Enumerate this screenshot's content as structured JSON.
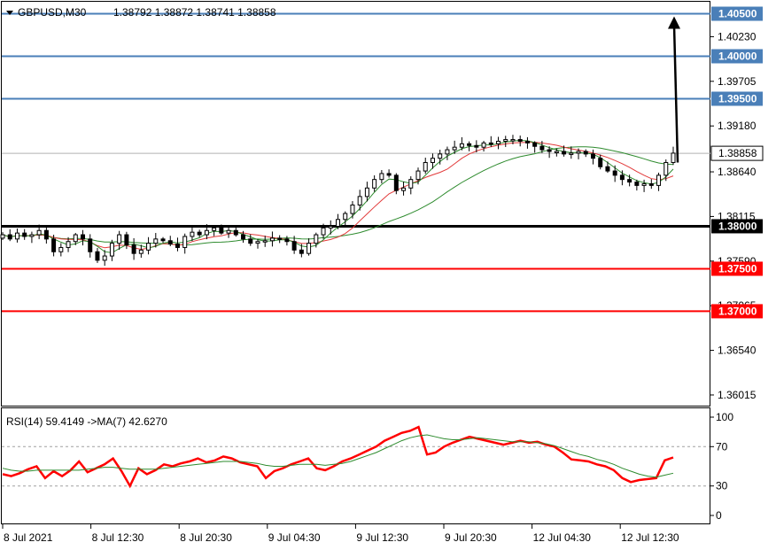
{
  "header": {
    "symbol_label": "GBPUSD,M30",
    "ohlc": "1.38792 1.38872 1.38741 1.38858"
  },
  "indicator": {
    "label": "RSI(14) 59.4149 ->MA(7) 42.6270",
    "levels": [
      "100",
      "70",
      "30",
      "0"
    ]
  },
  "colors": {
    "candle": "#000000",
    "ma_fast": "#2e8b2e",
    "ma_mid": "#e23a3a",
    "ma_slow": "#2e8b2e",
    "resistance": "#4a7fb8",
    "support_red": "#ff0000",
    "pivot": "#000000",
    "rsi": "#ff0000",
    "rsi_ma": "#2e8b2e"
  },
  "chart_data": [
    {
      "type": "candlestick",
      "symbol": "GBPUSD",
      "timeframe": "M30",
      "price_axis_labels": [
        "1.40230",
        "1.39705",
        "1.39180",
        "1.38640",
        "1.38115",
        "1.37590",
        "1.37065",
        "1.36540",
        "1.36015"
      ],
      "current_price_label": "1.38858",
      "ylim": [
        1.359,
        1.4062
      ],
      "time_axis_labels": [
        "8 Jul 2021",
        "8 Jul 12:30",
        "8 Jul 20:30",
        "9 Jul 04:30",
        "9 Jul 12:30",
        "9 Jul 20:30",
        "12 Jul 04:30",
        "12 Jul 12:30"
      ],
      "horizontal_levels": [
        {
          "price": 1.405,
          "label": "1.40500",
          "kind": "resistance"
        },
        {
          "price": 1.4,
          "label": "1.40000",
          "kind": "resistance"
        },
        {
          "price": 1.395,
          "label": "1.39500",
          "kind": "resistance"
        },
        {
          "price": 1.38,
          "label": "1.38000",
          "kind": "pivot"
        },
        {
          "price": 1.375,
          "label": "1.37500",
          "kind": "support_red"
        },
        {
          "price": 1.37,
          "label": "1.37000",
          "kind": "support_red"
        }
      ],
      "close_path": [
        1.379,
        1.3785,
        1.3792,
        1.3788,
        1.379,
        1.3795,
        1.3785,
        1.377,
        1.3775,
        1.3782,
        1.379,
        1.3785,
        1.377,
        1.376,
        1.3765,
        1.378,
        1.379,
        1.3778,
        1.3768,
        1.3772,
        1.378,
        1.3785,
        1.3783,
        1.3779,
        1.3775,
        1.3788,
        1.3793,
        1.379,
        1.3795,
        1.3798,
        1.3792,
        1.3795,
        1.379,
        1.3785,
        1.378,
        1.3782,
        1.3783,
        1.3786,
        1.3785,
        1.3782,
        1.3772,
        1.3768,
        1.378,
        1.379,
        1.3798,
        1.38,
        1.3808,
        1.3815,
        1.3825,
        1.3835,
        1.3845,
        1.3855,
        1.3862,
        1.386,
        1.3842,
        1.3845,
        1.3855,
        1.3865,
        1.3875,
        1.388,
        1.3885,
        1.389,
        1.3893,
        1.3897,
        1.3895,
        1.3893,
        1.3898,
        1.3897,
        1.39,
        1.3902,
        1.3902,
        1.39,
        1.3898,
        1.3894,
        1.389,
        1.3888,
        1.3888,
        1.3885,
        1.3886,
        1.3888,
        1.3885,
        1.388,
        1.387,
        1.3865,
        1.386,
        1.3855,
        1.3852,
        1.3848,
        1.385,
        1.3848,
        1.386,
        1.3875,
        1.3886
      ],
      "projection_arrow": {
        "from_price": 1.3875,
        "to_price": 1.405
      }
    },
    {
      "type": "line",
      "name": "RSI(14)",
      "ylim": [
        0,
        100
      ],
      "levels": [
        70,
        30
      ],
      "series": [
        {
          "name": "RSI(14)",
          "values": [
            42,
            40,
            43,
            47,
            50,
            38,
            45,
            40,
            46,
            55,
            44,
            48,
            52,
            58,
            45,
            30,
            48,
            42,
            46,
            52,
            50,
            53,
            55,
            58,
            54,
            56,
            60,
            58,
            54,
            52,
            50,
            38,
            45,
            48,
            52,
            55,
            58,
            48,
            46,
            50,
            55,
            58,
            62,
            66,
            70,
            76,
            80,
            84,
            86,
            90,
            62,
            64,
            70,
            74,
            77,
            80,
            78,
            76,
            74,
            72,
            74,
            76,
            74,
            75,
            72,
            70,
            64,
            57,
            56,
            55,
            52,
            50,
            46,
            38,
            34,
            36,
            37,
            38,
            56,
            59
          ]
        },
        {
          "name": "MA(7)",
          "values": [
            48,
            46,
            45,
            45,
            46,
            46,
            46,
            46,
            46,
            46,
            47,
            48,
            49,
            49,
            48,
            47,
            47,
            47,
            47,
            48,
            49,
            50,
            51,
            52,
            53,
            54,
            55,
            55,
            55,
            54,
            53,
            51,
            50,
            50,
            51,
            52,
            52,
            52,
            51,
            52,
            53,
            55,
            58,
            61,
            64,
            68,
            72,
            76,
            79,
            81,
            82,
            80,
            78,
            77,
            77,
            78,
            79,
            78,
            77,
            76,
            75,
            75,
            75,
            74,
            73,
            71,
            68,
            65,
            62,
            60,
            57,
            55,
            52,
            48,
            45,
            42,
            40,
            39,
            41,
            43
          ]
        }
      ]
    }
  ]
}
